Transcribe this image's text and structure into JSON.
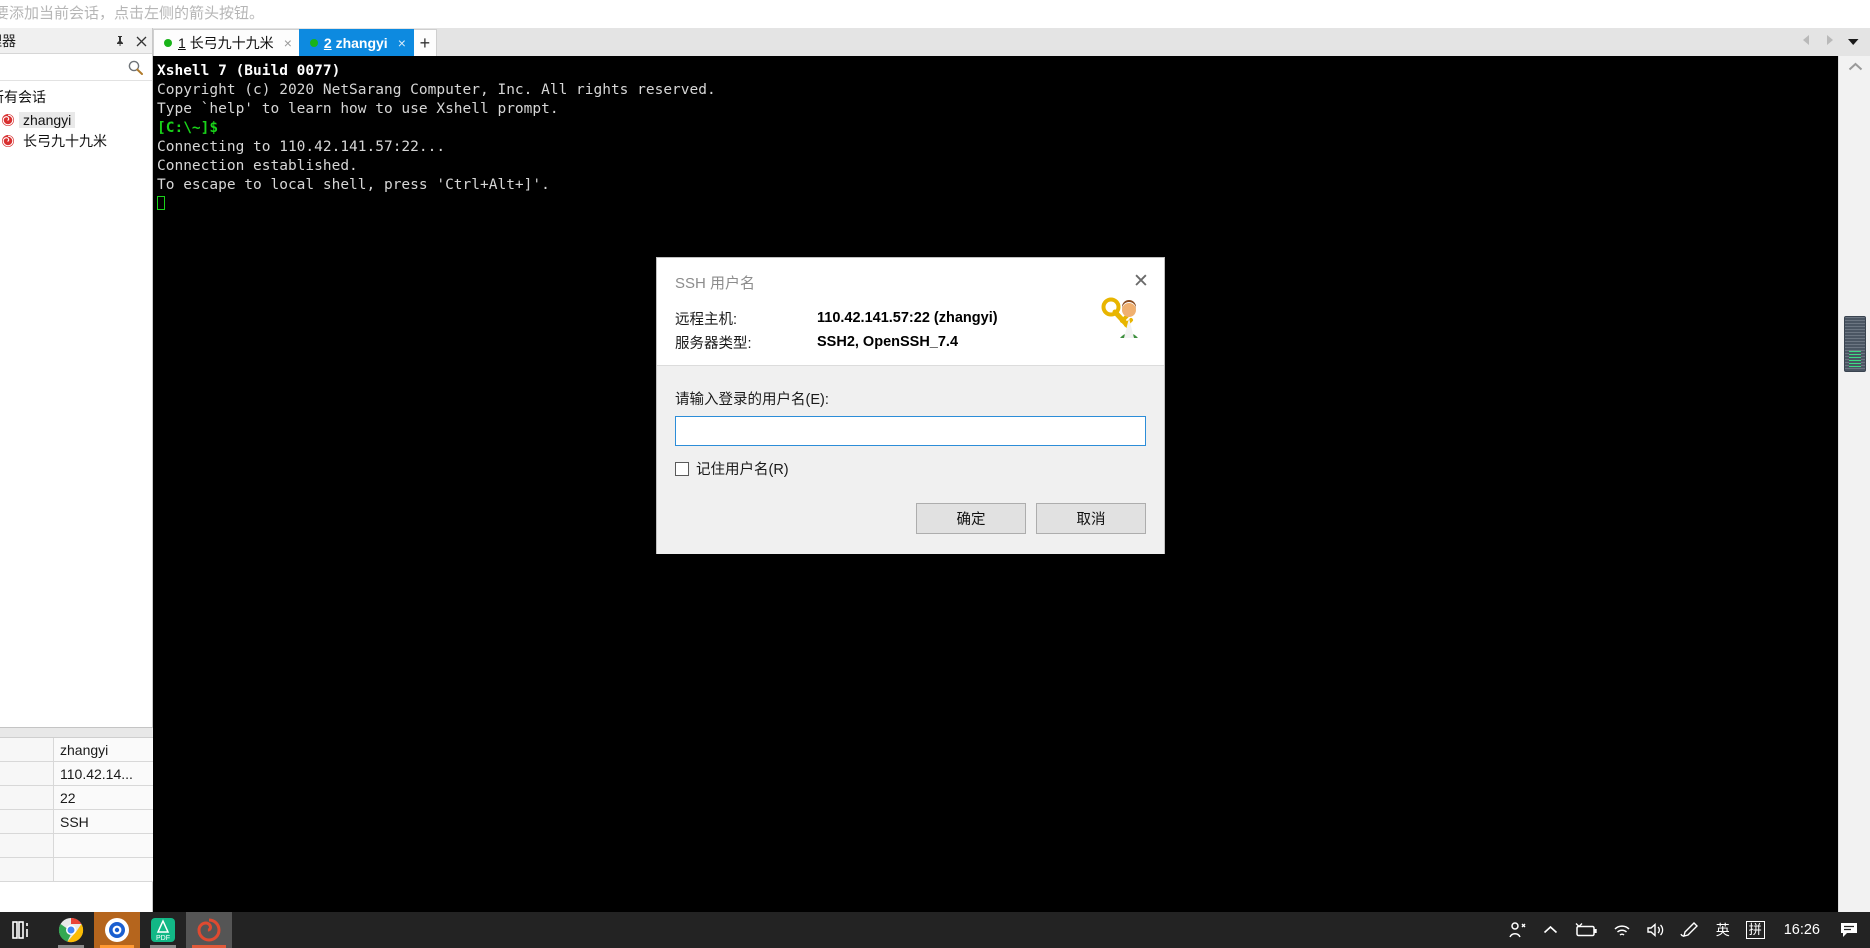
{
  "hint_banner": {
    "text": "要添加当前会话，点击左侧的箭头按钮。"
  },
  "session_manager": {
    "title": "理器",
    "pin_icon": "pin-icon",
    "close_icon": "close-icon",
    "search_icon": "search-icon",
    "root_label": "所有会话",
    "sessions": [
      {
        "label": "zhangyi",
        "selected": true
      },
      {
        "label": "长弓九十九米",
        "selected": false
      }
    ]
  },
  "properties": {
    "rows": [
      {
        "key": "",
        "value": "zhangyi"
      },
      {
        "key": "",
        "value": "110.42.14..."
      },
      {
        "key": "",
        "value": "22"
      },
      {
        "key": "",
        "value": "SSH"
      },
      {
        "key": "",
        "value": ""
      },
      {
        "key": "",
        "value": ""
      }
    ]
  },
  "tabs": {
    "items": [
      {
        "num": "1",
        "label": "长弓九十九米",
        "active": false,
        "close": "×",
        "status": "connected"
      },
      {
        "num": "2",
        "label": "zhangyi",
        "active": true,
        "close": "×",
        "status": "connected"
      }
    ],
    "add_label": "+",
    "nav_left": "◀",
    "nav_right": "▶",
    "nav_menu": "▼"
  },
  "terminal": {
    "lines": [
      {
        "text": "Xshell 7 (Build 0077)",
        "style": "bold"
      },
      {
        "text": "Copyright (c) 2020 NetSarang Computer, Inc. All rights reserved.",
        "style": "normal"
      },
      {
        "text": "",
        "style": "normal"
      },
      {
        "text": "Type `help' to learn how to use Xshell prompt.",
        "style": "normal"
      },
      {
        "text": "[C:\\~]$",
        "style": "green"
      },
      {
        "text": "",
        "style": "normal"
      },
      {
        "text": "Connecting to 110.42.141.57:22...",
        "style": "normal"
      },
      {
        "text": "Connection established.",
        "style": "normal"
      },
      {
        "text": "To escape to local shell, press 'Ctrl+Alt+]'.",
        "style": "normal"
      }
    ]
  },
  "dialog": {
    "title": "SSH 用户名",
    "close_label": "✕",
    "icon": "key-user-icon",
    "info": [
      {
        "key": "远程主机:",
        "value": "110.42.141.57:22 (zhangyi)"
      },
      {
        "key": "服务器类型:",
        "value": "SSH2, OpenSSH_7.4"
      }
    ],
    "field_label": "请输入登录的用户名(E):",
    "field_value": "",
    "field_placeholder": "",
    "checkbox_label": "记住用户名(R)",
    "checkbox_checked": false,
    "ok_label": "确定",
    "cancel_label": "取消"
  },
  "taskbar": {
    "start_icon": "task-view-icon",
    "apps": [
      {
        "name": "chrome-icon",
        "state": "idle"
      },
      {
        "name": "browser-icon",
        "state": "active"
      },
      {
        "name": "pdf-icon",
        "state": "idle"
      },
      {
        "name": "xshell-icon",
        "state": "minimized"
      }
    ],
    "tray": [
      {
        "name": "people-icon",
        "glyph": ""
      },
      {
        "name": "chevron-up-icon",
        "glyph": ""
      },
      {
        "name": "battery-icon",
        "glyph": ""
      },
      {
        "name": "wifi-icon",
        "glyph": ""
      },
      {
        "name": "volume-icon",
        "glyph": ""
      },
      {
        "name": "pen-icon",
        "glyph": ""
      },
      {
        "name": "ime-english-icon",
        "glyph": "英"
      },
      {
        "name": "ime-pinyin-icon",
        "glyph": "拼"
      }
    ],
    "clock": "16:26",
    "notification_icon": "notification-icon"
  },
  "colors": {
    "accent": "#0d8ae0",
    "terminal_bg": "#000000",
    "terminal_green": "#19d219",
    "taskbar_bg": "#232323"
  }
}
